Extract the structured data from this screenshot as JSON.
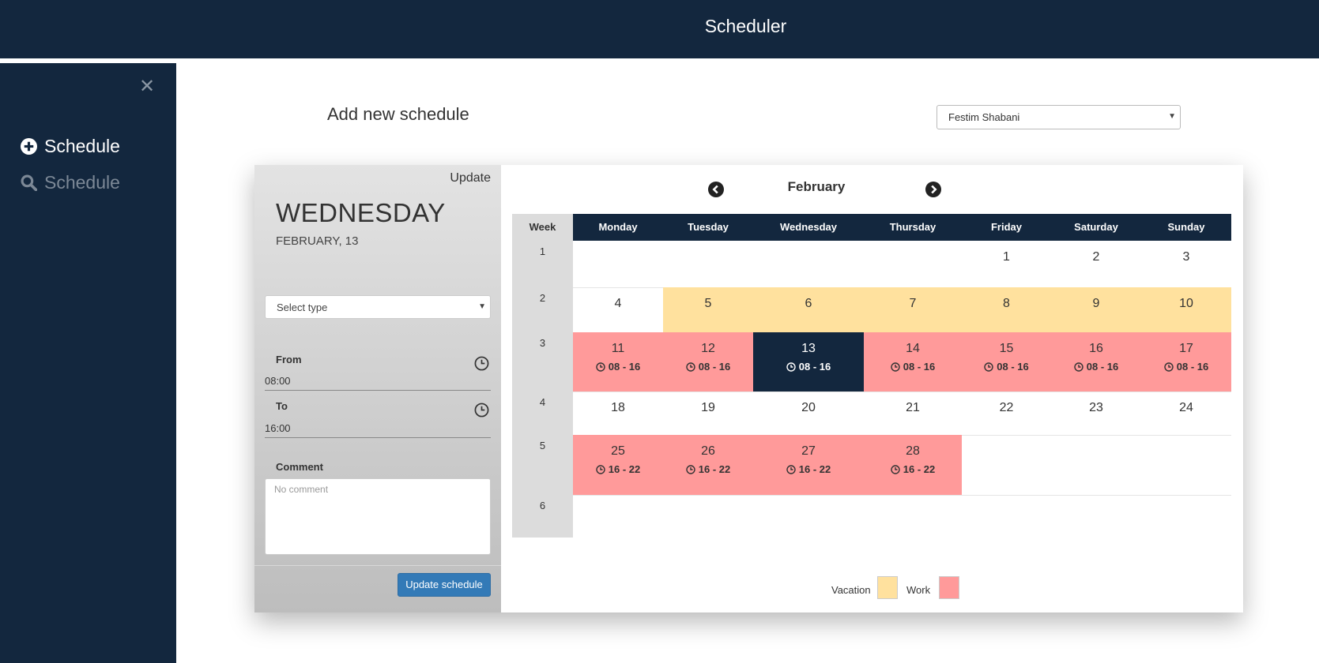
{
  "header": {
    "title": "Scheduler"
  },
  "sidebar": {
    "close_glyph": "✕",
    "items": [
      {
        "label": "Schedule",
        "icon": "plus-circle-icon",
        "active": true
      },
      {
        "label": "Schedule",
        "icon": "search-icon",
        "active": false
      }
    ]
  },
  "main": {
    "title": "Add new schedule",
    "user_select": {
      "value": "Festim Shabani"
    }
  },
  "editor": {
    "update_link": "Update",
    "day_name": "WEDNESDAY",
    "date": "FEBRUARY, 13",
    "type_select": {
      "placeholder": "Select type"
    },
    "from": {
      "label": "From",
      "value": "08:00"
    },
    "to": {
      "label": "To",
      "value": "16:00"
    },
    "comment": {
      "label": "Comment",
      "placeholder": "No comment"
    },
    "submit_label": "Update schedule"
  },
  "calendar": {
    "month": "February",
    "week_header": "Week",
    "days": [
      "Monday",
      "Tuesday",
      "Wednesday",
      "Thursday",
      "Friday",
      "Saturday",
      "Sunday"
    ],
    "weeks": [
      "1",
      "2",
      "3",
      "4",
      "5",
      "6"
    ],
    "rows": [
      [
        null,
        null,
        null,
        null,
        {
          "d": "1"
        },
        {
          "d": "2"
        },
        {
          "d": "3"
        }
      ],
      [
        {
          "d": "4"
        },
        {
          "d": "5",
          "type": "vacation"
        },
        {
          "d": "6",
          "type": "vacation"
        },
        {
          "d": "7",
          "type": "vacation"
        },
        {
          "d": "8",
          "type": "vacation"
        },
        {
          "d": "9",
          "type": "vacation"
        },
        {
          "d": "10",
          "type": "vacation"
        }
      ],
      [
        {
          "d": "11",
          "type": "work",
          "hours": "08 - 16"
        },
        {
          "d": "12",
          "type": "work",
          "hours": "08 - 16"
        },
        {
          "d": "13",
          "type": "selected",
          "hours": "08 - 16"
        },
        {
          "d": "14",
          "type": "work",
          "hours": "08 - 16"
        },
        {
          "d": "15",
          "type": "work",
          "hours": "08 - 16"
        },
        {
          "d": "16",
          "type": "work",
          "hours": "08 - 16"
        },
        {
          "d": "17",
          "type": "work",
          "hours": "08 - 16"
        }
      ],
      [
        {
          "d": "18"
        },
        {
          "d": "19"
        },
        {
          "d": "20"
        },
        {
          "d": "21"
        },
        {
          "d": "22"
        },
        {
          "d": "23"
        },
        {
          "d": "24"
        }
      ],
      [
        {
          "d": "25",
          "type": "work",
          "hours": "16 - 22"
        },
        {
          "d": "26",
          "type": "work",
          "hours": "16 - 22"
        },
        {
          "d": "27",
          "type": "work",
          "hours": "16 - 22"
        },
        {
          "d": "28",
          "type": "work",
          "hours": "16 - 22"
        },
        null,
        null,
        null
      ],
      [
        null,
        null,
        null,
        null,
        null,
        null,
        null
      ]
    ],
    "legend": [
      {
        "label": "Vacation",
        "color": "#ffe19e"
      },
      {
        "label": "Work",
        "color": "#ff9a9a"
      }
    ],
    "colors": {
      "vacation": "#ffe19e",
      "work": "#ff9a9a",
      "selected": "#13273e",
      "header": "#13273e"
    }
  }
}
